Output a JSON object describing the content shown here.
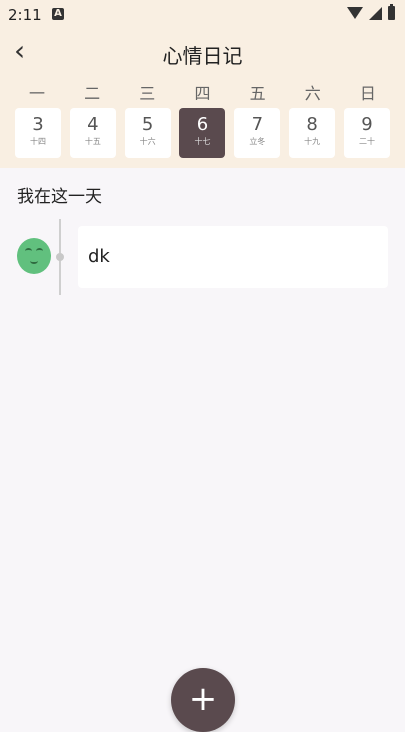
{
  "status_bar": {
    "time": "2:11",
    "notification_icon": "A"
  },
  "header": {
    "back_icon": "‹",
    "title": "心情日记"
  },
  "weekdays": [
    "一",
    "二",
    "三",
    "四",
    "五",
    "六",
    "日"
  ],
  "days": [
    {
      "num": "3",
      "lunar": "十四"
    },
    {
      "num": "4",
      "lunar": "十五"
    },
    {
      "num": "5",
      "lunar": "十六"
    },
    {
      "num": "6",
      "lunar": "十七",
      "selected": true
    },
    {
      "num": "7",
      "lunar": "立冬"
    },
    {
      "num": "8",
      "lunar": "十九"
    },
    {
      "num": "9",
      "lunar": "二十"
    }
  ],
  "section": {
    "title": "我在这一天"
  },
  "entries": [
    {
      "text": "dk",
      "mood_icon": "smiley-face-icon"
    }
  ],
  "fab": {
    "label": "+"
  },
  "colors": {
    "header_bg": "#f9efe2",
    "accent": "#5a4a4e",
    "mood_green": "#61c07e"
  }
}
